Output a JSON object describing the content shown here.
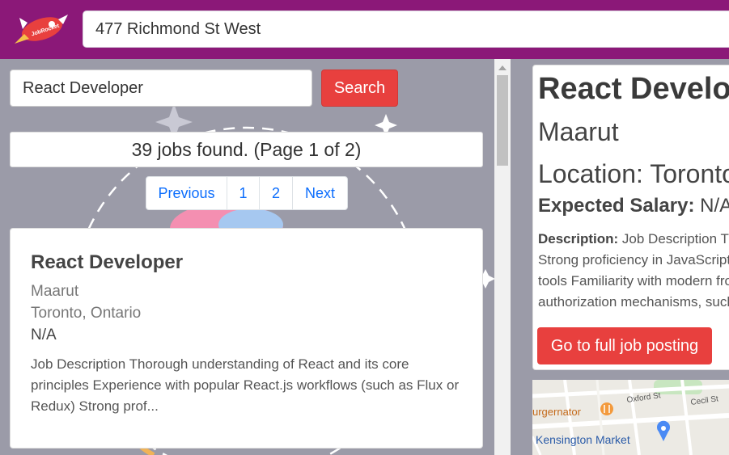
{
  "header": {
    "logo_text": "JobRocket",
    "address_value": "477 Richmond St West"
  },
  "search": {
    "query_value": "React Developer",
    "button_label": "Search"
  },
  "results": {
    "summary": "39 jobs found. (Page 1 of 2)"
  },
  "pagination": {
    "items": [
      "Previous",
      "1",
      "2",
      "Next"
    ]
  },
  "job_card": {
    "title": "React Developer",
    "company": "Maarut",
    "location": "Toronto, Ontario",
    "salary": "N/A",
    "description": "Job Description Thorough understanding of React and its core principles Experience with popular React.js workflows (such as Flux or Redux) Strong prof..."
  },
  "detail": {
    "title": "React Developer",
    "company": "Maarut",
    "location": "Location: Toronto, Ontario",
    "salary_label": "Expected Salary:",
    "salary_value": "N/A",
    "description_label": "Description:",
    "description_lines": [
      "Job Description Thorough understanding of React and its core principles",
      "Strong proficiency in JavaScript, including DOM manipulation",
      "tools Familiarity with modern front-end build pipelines and",
      "authorization mechanisms, such as JSON Web Token"
    ],
    "button_label": "Go to full job posting"
  },
  "map": {
    "labels": [
      "Oxford St",
      "Cecil St",
      "urgernator",
      "Kensington Market"
    ]
  },
  "colors": {
    "header_bg": "#8b1878",
    "accent_red": "#e8403e",
    "link_blue": "#0d6efd",
    "panel_bg": "#9b9ba8"
  }
}
